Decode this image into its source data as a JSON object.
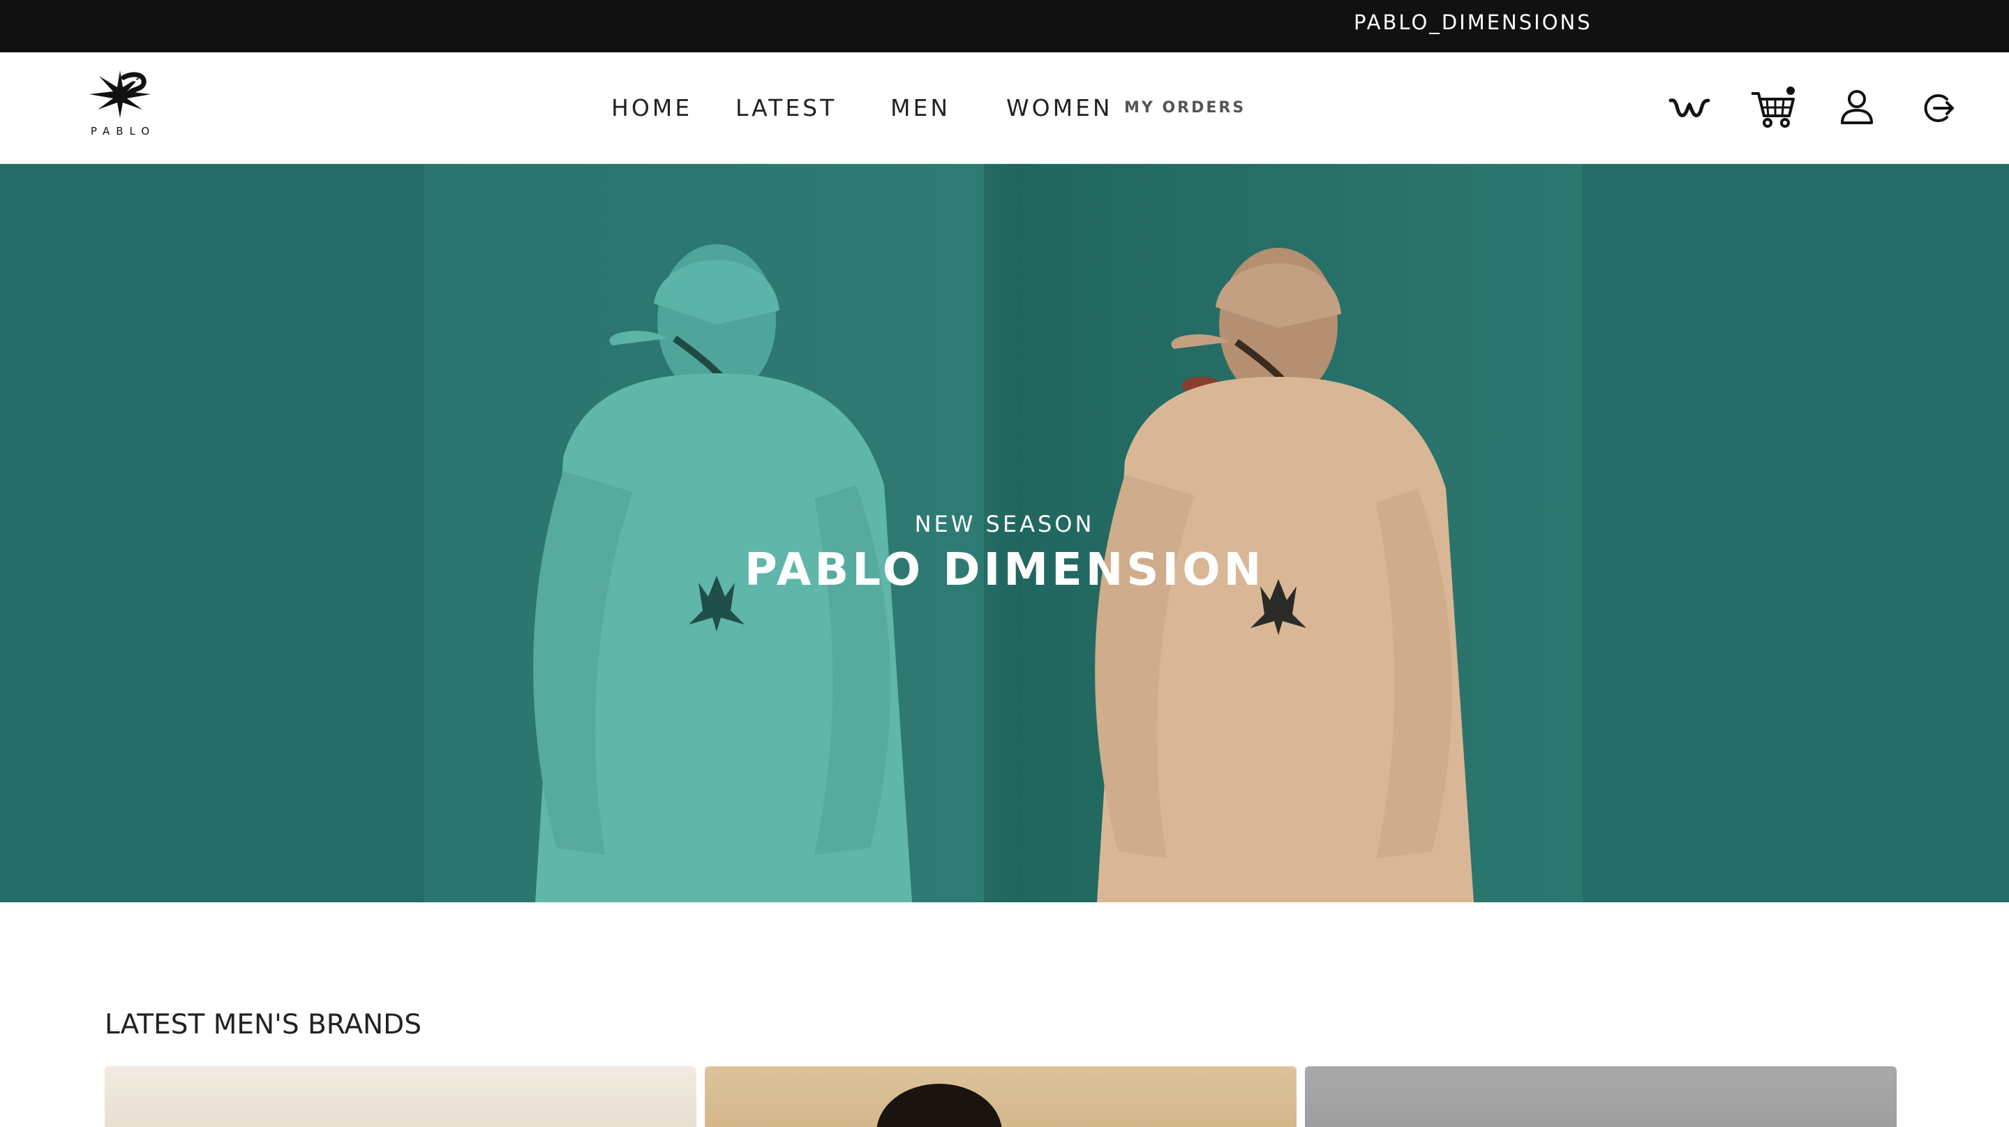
{
  "topbar": {
    "text": "PABLO_DIMENSIONS"
  },
  "logo": {
    "word": "PABLO"
  },
  "nav": {
    "home": "HOME",
    "latest": "LATEST",
    "men": "MEN",
    "women": "WOMEN",
    "orders": "MY ORDERS"
  },
  "icons": [
    "wishlist-icon",
    "cart-icon",
    "user-icon",
    "logout-icon"
  ],
  "hero": {
    "kicker": "NEW SEASON",
    "title": "PABLO DIMENSION",
    "background": "#246c66"
  },
  "brands": {
    "title": "LATEST MEN'S BRANDS"
  }
}
